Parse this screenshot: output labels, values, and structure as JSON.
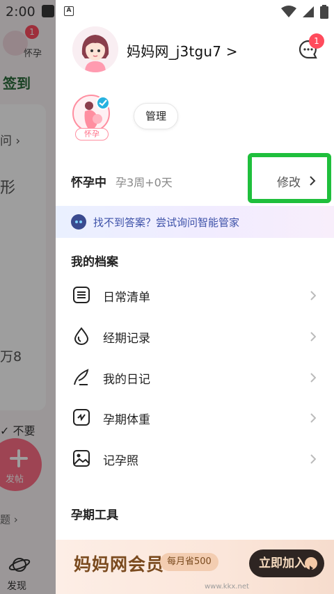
{
  "status_bar": {
    "time": "2:00",
    "notification_letter": "A"
  },
  "background": {
    "badge_count": "1",
    "stage_label": "怀孕",
    "sign_in": "签到",
    "question": "问",
    "shape": "形",
    "wan": "万8",
    "not_want": "不要",
    "post": "发帖",
    "topic": "题",
    "discover": "发现"
  },
  "drawer": {
    "username": "妈妈网_j3tgu7",
    "message_badge": "1",
    "pregnancy_tag": "怀孕",
    "manage_button": "管理",
    "status_main": "怀孕中",
    "status_sub": "孕3周+0天",
    "edit_button": "修改",
    "assistant_text": "找不到答案？尝试询问智能管家",
    "archive_title": "我的档案",
    "menu": [
      {
        "label": "日常清单",
        "icon": "checklist-icon"
      },
      {
        "label": "经期记录",
        "icon": "droplet-icon"
      },
      {
        "label": "我的日记",
        "icon": "feather-icon"
      },
      {
        "label": "孕期体重",
        "icon": "scale-icon"
      },
      {
        "label": "记孕照",
        "icon": "photo-icon"
      }
    ],
    "tools_title": "孕期工具",
    "vip": {
      "title": "妈妈网会员",
      "savings": "每月省500",
      "join_button": "立即加入"
    }
  },
  "watermark": "www.kkx.net",
  "colors": {
    "highlight_border": "#1fbf3c",
    "badge_red": "#ff4b5c",
    "pink_accent": "#ff8ea0",
    "assistant_blue": "#3d51a8",
    "vip_brown": "#7a4a1e"
  }
}
